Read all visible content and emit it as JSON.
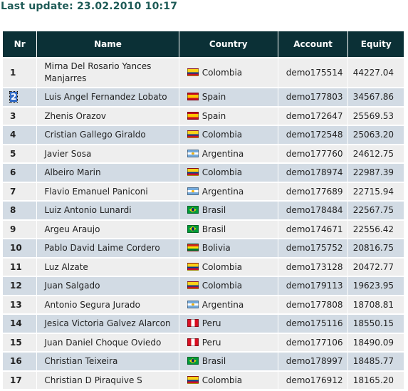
{
  "last_update": "Last update: 23.02.2010 10:17",
  "headers": {
    "nr": "Nr",
    "name": "Name",
    "country": "Country",
    "account": "Account",
    "equity": "Equity"
  },
  "rows": [
    {
      "nr": "1",
      "name": "Mirna Del Rosario Yances Manjarres",
      "country": "Colombia",
      "flag": "colombia",
      "account": "demo175514",
      "equity": "44227.04"
    },
    {
      "nr": "2",
      "name": "Luis Angel Fernandez Lobato",
      "country": "Spain",
      "flag": "spain",
      "account": "demo177803",
      "equity": "34567.86"
    },
    {
      "nr": "3",
      "name": "Zhenis Orazov",
      "country": "Spain",
      "flag": "spain",
      "account": "demo172647",
      "equity": "25569.53"
    },
    {
      "nr": "4",
      "name": "Cristian Gallego Giraldo",
      "country": "Colombia",
      "flag": "colombia",
      "account": "demo172548",
      "equity": "25063.20"
    },
    {
      "nr": "5",
      "name": "Javier Sosa",
      "country": "Argentina",
      "flag": "argentina",
      "account": "demo177760",
      "equity": "24612.75"
    },
    {
      "nr": "6",
      "name": "Albeiro Marin",
      "country": "Colombia",
      "flag": "colombia",
      "account": "demo178974",
      "equity": "22987.39"
    },
    {
      "nr": "7",
      "name": "Flavio Emanuel Paniconi",
      "country": "Argentina",
      "flag": "argentina",
      "account": "demo177689",
      "equity": "22715.94"
    },
    {
      "nr": "8",
      "name": "Luiz Antonio Lunardi",
      "country": "Brasil",
      "flag": "brasil",
      "account": "demo178484",
      "equity": "22567.75"
    },
    {
      "nr": "9",
      "name": "Argeu Araujo",
      "country": "Brasil",
      "flag": "brasil",
      "account": "demo174671",
      "equity": "22556.42"
    },
    {
      "nr": "10",
      "name": "Pablo David Laime Cordero",
      "country": "Bolivia",
      "flag": "bolivia",
      "account": "demo175752",
      "equity": "20816.75"
    },
    {
      "nr": "11",
      "name": "Luz Alzate",
      "country": "Colombia",
      "flag": "colombia",
      "account": "demo173128",
      "equity": "20472.77"
    },
    {
      "nr": "12",
      "name": "Juan Salgado",
      "country": "Colombia",
      "flag": "colombia",
      "account": "demo179113",
      "equity": "19623.95"
    },
    {
      "nr": "13",
      "name": "Antonio Segura Jurado",
      "country": "Argentina",
      "flag": "argentina",
      "account": "demo177808",
      "equity": "18708.81"
    },
    {
      "nr": "14",
      "name": "Jesica Victoria Galvez Alarcon",
      "country": "Peru",
      "flag": "peru",
      "account": "demo175116",
      "equity": "18550.15"
    },
    {
      "nr": "15",
      "name": "Juan Daniel Choque Oviedo",
      "country": "Peru",
      "flag": "peru",
      "account": "demo177106",
      "equity": "18490.09"
    },
    {
      "nr": "16",
      "name": "Christian Teixeira",
      "country": "Brasil",
      "flag": "brasil",
      "account": "demo178997",
      "equity": "18485.77"
    },
    {
      "nr": "17",
      "name": "Christian D Piraquive S",
      "country": "Colombia",
      "flag": "colombia",
      "account": "demo176912",
      "equity": "18165.20"
    }
  ]
}
